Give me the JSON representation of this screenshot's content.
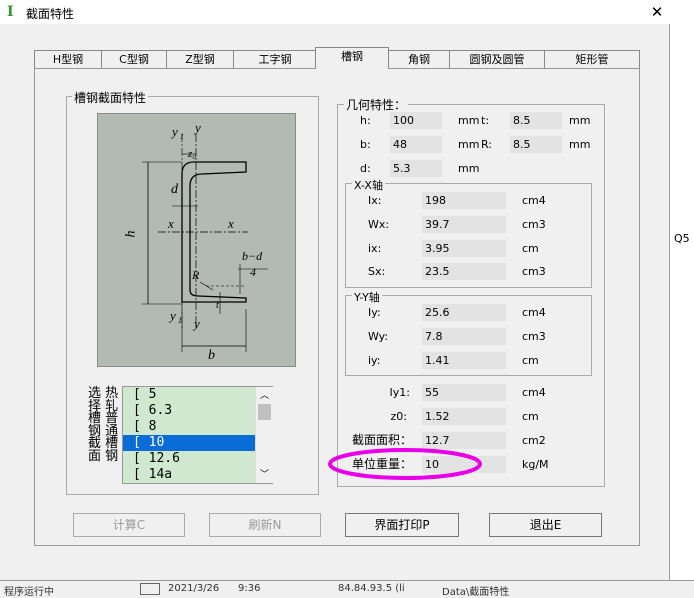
{
  "window": {
    "title": "截面特性",
    "app_icon": "I"
  },
  "tabs": [
    {
      "label": "H型钢"
    },
    {
      "label": "C型钢"
    },
    {
      "label": "Z型钢"
    },
    {
      "label": "工字钢"
    },
    {
      "label": "槽钢",
      "active": true
    },
    {
      "label": "角钢"
    },
    {
      "label": "圆钢及圆管"
    },
    {
      "label": "矩形管"
    }
  ],
  "section_group": {
    "title": "槽钢截面特性"
  },
  "figure_labels": {
    "y1_top": "y",
    "y1_top_sub": "1",
    "y_top": "y",
    "z0": "z₀",
    "d": "d",
    "h": "h",
    "x_left": "x",
    "x_right": "x",
    "R": "R",
    "t": "t",
    "bd_num": "b−d",
    "bd_den": "4",
    "y1_bot": "y",
    "y1_bot_sub": "1",
    "y_bot": "y",
    "b": "b"
  },
  "list_labels": {
    "col1": "选择钢截面",
    "col2": "热轧槽钢",
    "col3": "普通"
  },
  "list_labels_display": [
    "选 热",
    "择 轧",
    "槽 普",
    "钢 通",
    "截 槽",
    "面 钢"
  ],
  "list_items": [
    "[ 5",
    "[ 6.3",
    "[ 8",
    "[ 10",
    "[ 12.6",
    "[ 14a"
  ],
  "list_selected_index": 3,
  "geometry": {
    "title": "几何特性：",
    "h": {
      "label": "h:",
      "value": "100",
      "unit": "mm"
    },
    "t": {
      "label": "t:",
      "value": "8.5",
      "unit": "mm"
    },
    "b": {
      "label": "b:",
      "value": "48",
      "unit": "mm"
    },
    "R": {
      "label": "R:",
      "value": "8.5",
      "unit": "mm"
    },
    "d": {
      "label": "d:",
      "value": "5.3",
      "unit": "mm"
    }
  },
  "xx": {
    "title": "X-X轴",
    "Ix": {
      "label": "Ix:",
      "value": "198",
      "unit": "cm4"
    },
    "Wx": {
      "label": "Wx:",
      "value": "39.7",
      "unit": "cm3"
    },
    "ix": {
      "label": "ix:",
      "value": "3.95",
      "unit": "cm"
    },
    "Sx": {
      "label": "Sx:",
      "value": "23.5",
      "unit": "cm3"
    }
  },
  "yy": {
    "title": "Y-Y轴",
    "Iy": {
      "label": "Iy:",
      "value": "25.6",
      "unit": "cm4"
    },
    "Wy": {
      "label": "Wy:",
      "value": "7.8",
      "unit": "cm3"
    },
    "iy": {
      "label": "iy:",
      "value": "1.41",
      "unit": "cm"
    }
  },
  "other": {
    "Iy1": {
      "label": "Iy1:",
      "value": "55",
      "unit": "cm4"
    },
    "z0": {
      "label": "z0:",
      "value": "1.52",
      "unit": "cm"
    },
    "area": {
      "label": "截面面积：",
      "value": "12.7",
      "unit": "cm2"
    },
    "weight": {
      "label": "单位重量：",
      "value": "10",
      "unit": "kg/M"
    }
  },
  "buttons": {
    "calc": "计算C",
    "refresh": "刷新N",
    "print": "界面打印P",
    "exit": "退出E"
  },
  "statusbar": {
    "s1": "程序运行中",
    "s2": "2021/3/26",
    "s3": "9:36",
    "s4": "84.84.93.5 (li",
    "s5": "Data\\截面特性"
  },
  "background_text": "Q5",
  "highlight_color": "#e800e8"
}
